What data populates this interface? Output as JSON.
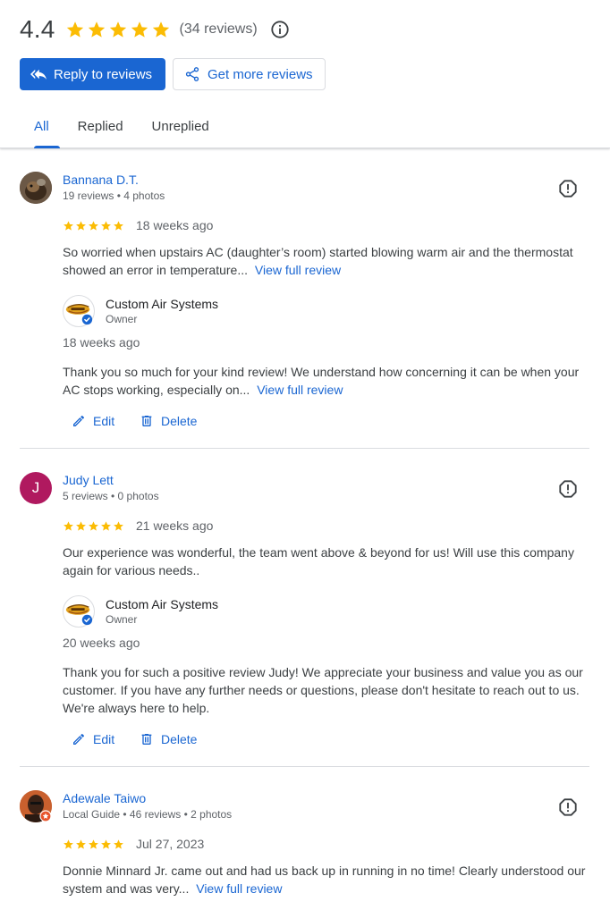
{
  "summary": {
    "rating": "4.4",
    "stars": 5,
    "count": "(34 reviews)"
  },
  "actions": {
    "reply_label": "Reply to reviews",
    "get_more_label": "Get more reviews"
  },
  "tabs": [
    {
      "label": "All",
      "active": true
    },
    {
      "label": "Replied",
      "active": false
    },
    {
      "label": "Unreplied",
      "active": false
    }
  ],
  "reviews": [
    {
      "name": "Bannana D.T.",
      "meta": "19 reviews • 4 photos",
      "stars": 5,
      "date": "18 weeks ago",
      "text": "So worried when upstairs AC (daughter’s room) started blowing warm air and the thermostat showed an error in temperature...",
      "view_full": "View full review",
      "reply": {
        "owner_name": "Custom Air Systems",
        "owner_role": "Owner",
        "date": "18 weeks ago",
        "text": "Thank you so much for your kind review! We understand how concerning it can be when your AC stops working, especially on...",
        "view_full": "View full review"
      },
      "edit_label": "Edit",
      "delete_label": "Delete"
    },
    {
      "name": "Judy Lett",
      "avatar_letter": "J",
      "avatar_color": "#b0195f",
      "meta": "5 reviews • 0 photos",
      "stars": 5,
      "date": "21 weeks ago",
      "text": "Our experience was wonderful, the team went above & beyond for us! Will use this company again for various needs..",
      "reply": {
        "owner_name": "Custom Air Systems",
        "owner_role": "Owner",
        "date": "20 weeks ago",
        "text": "Thank you for such a positive review Judy! We appreciate your business and value you as our customer. If you have any further needs or questions, please don't hesitate to reach out to us. We're always here to help."
      },
      "edit_label": "Edit",
      "delete_label": "Delete"
    },
    {
      "name": "Adewale Taiwo",
      "meta": "Local Guide • 46 reviews • 2 photos",
      "stars": 5,
      "date": "Jul 27, 2023",
      "text": "Donnie Minnard Jr. came out and had us back up in running in no time! Clearly understood our system and was very...",
      "view_full": "View full review"
    }
  ],
  "colors": {
    "accent": "#1a66d2",
    "star": "#fbbc04",
    "divider": "#dadce0"
  }
}
